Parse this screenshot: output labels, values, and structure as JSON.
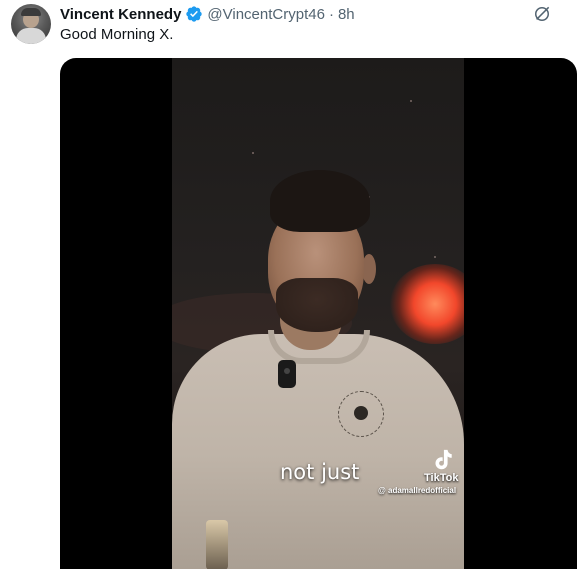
{
  "tweet": {
    "author_name": "Vincent Kennedy",
    "handle": "@VincentCrypt46",
    "separator": "·",
    "time": "8h",
    "text": "Good Morning X.",
    "verified_color": "#1d9bf0"
  },
  "media": {
    "caption": "not just",
    "watermark_brand": "TikTok",
    "watermark_user": "@ adamallredofficial"
  },
  "icons": {
    "verified": "verified-badge-icon",
    "more": "grok-icon",
    "tiktok": "tiktok-logo-icon"
  }
}
